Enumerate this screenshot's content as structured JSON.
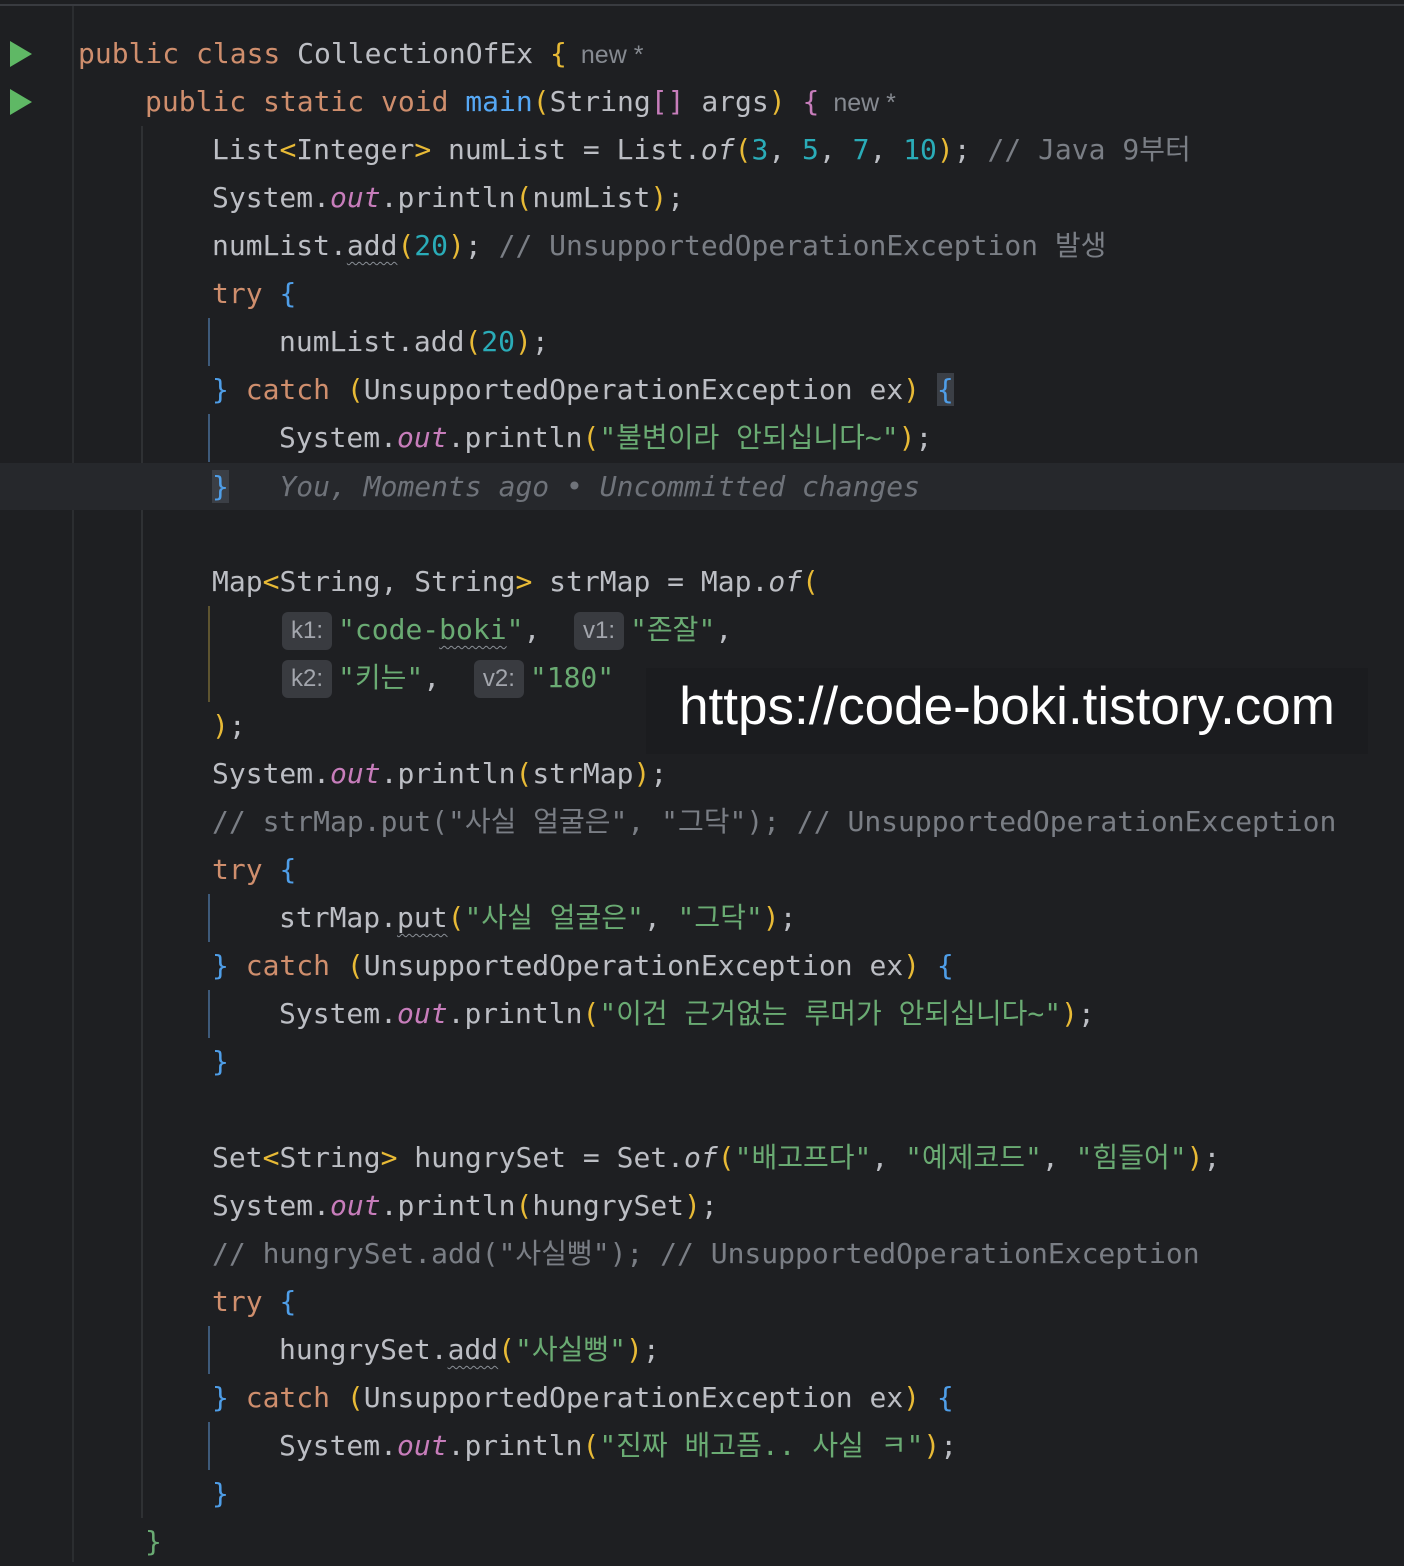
{
  "editor": {
    "hints": {
      "new1": "new *",
      "new2": "new *"
    },
    "blame": "You, Moments ago • Uncommitted changes",
    "param_hints": {
      "k1": "k1:",
      "v1": "v1:",
      "k2": "k2:",
      "v2": "v2:"
    },
    "code": {
      "class_name": "CollectionOfEx",
      "main_name": "main",
      "comment_java9": "// Java 9부터",
      "comment_unsupported_1": "// UnsupportedOperationException 발생",
      "str_immutable": "\"불변이라 안되십니다~\"",
      "str_codeboki_a": "\"code-",
      "str_codeboki_b": "boki",
      "str_codeboki_c": "\"",
      "str_jonjal": "\"존잘\"",
      "str_kineun": "\"키는\"",
      "str_180": "\"180\"",
      "comment_map_put": "// strMap.put(\"사실 얼굴은\", \"그닥\"); // UnsupportedOperationException",
      "str_fact_face": "\"사실 얼굴은\"",
      "str_geudak": "\"그닥\"",
      "str_rumor": "\"이건 근거없는 루머가 안되십니다~\"",
      "str_hungry": "\"배고프다\"",
      "str_example": "\"예제코드\"",
      "str_tired": "\"힘들어\"",
      "comment_set_add": "// hungrySet.add(\"사실뻥\"); // UnsupportedOperationException",
      "str_lie": "\"사실뻥\"",
      "str_really_hungry": "\"진짜 배고픔.. 사실 ㅋ\""
    }
  },
  "watermark": "https://code-boki.tistory.com",
  "colors": {
    "background": "#1e1f22",
    "keyword": "#cf8e6d",
    "string": "#6aab73",
    "number": "#2aacb8",
    "comment": "#7a7e85",
    "function": "#56a8f5",
    "static_field": "#c77dbb",
    "run_icon": "#5fb865"
  }
}
